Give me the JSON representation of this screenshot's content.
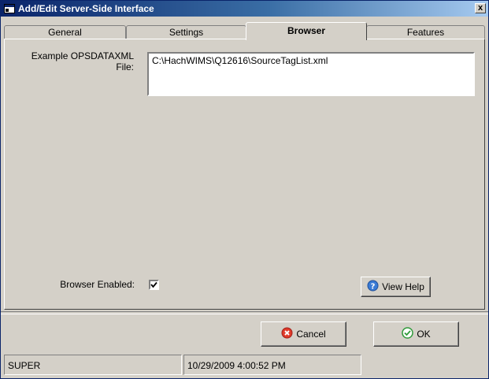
{
  "window": {
    "title": "Add/Edit Server-Side Interface",
    "close_label": "x"
  },
  "tabs": [
    {
      "label": "General"
    },
    {
      "label": "Settings"
    },
    {
      "label": "Browser",
      "active": true
    },
    {
      "label": "Features"
    }
  ],
  "browser": {
    "file_label_line1": "Example OPSDATAXML",
    "file_label_line2": "File:",
    "file_value": "C:\\HachWIMS\\Q12616\\SourceTagList.xml",
    "enabled_label": "Browser Enabled:",
    "enabled_checked": true,
    "view_help_label": "View Help"
  },
  "buttons": {
    "cancel_label": "Cancel",
    "ok_label": "OK"
  },
  "status": {
    "user": "SUPER",
    "timestamp": "10/29/2009 4:00:52 PM"
  },
  "icons": {
    "title": "window-app-icon",
    "help": "help-question-icon",
    "cancel": "cancel-x-icon",
    "ok": "ok-check-icon"
  }
}
